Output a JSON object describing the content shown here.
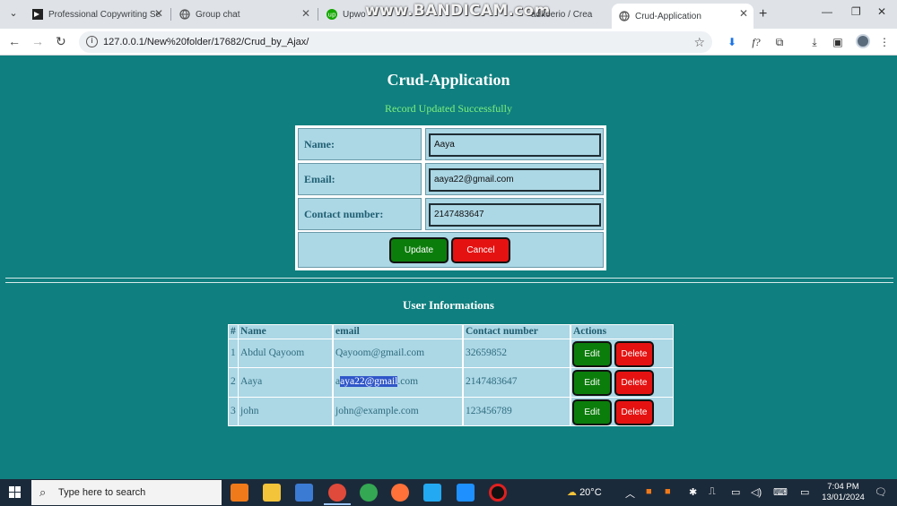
{
  "browser": {
    "tabs": [
      {
        "title": "Professional Copywriting Se",
        "active": false
      },
      {
        "title": "Group chat",
        "active": false
      },
      {
        "title": "Upwor",
        "active": false
      },
      {
        "title": "adkeerio / Crea",
        "active": false
      },
      {
        "title": "Crud-Application",
        "active": true
      }
    ],
    "new_tab_label": "+",
    "watermark": "www.BANDICAM.com",
    "url": "127.0.0.1/New%20folder/17682/Crud_by_Ajax/"
  },
  "page": {
    "title": "Crud-Application",
    "status_message": "Record Updated Successfully",
    "form": {
      "name_label": "Name:",
      "name_value": "Aaya",
      "email_label": "Email:",
      "email_value": "aaya22@gmail.com",
      "contact_label": "Contact number:",
      "contact_value": "2147483647",
      "update_label": "Update",
      "cancel_label": "Cancel"
    },
    "users_section": {
      "title": "User Informations",
      "headers": [
        "#",
        "Name",
        "email",
        "Contact number",
        "Actions"
      ],
      "rows": [
        {
          "id": "1",
          "name": "Abdul Qayoom",
          "email": "Qayoom@gmail.com",
          "contact": "32659852"
        },
        {
          "id": "2",
          "name": "Aaya",
          "email_pre": "a",
          "email_sel": "aya22@gmail",
          "email_post": ".com",
          "contact": "2147483647"
        },
        {
          "id": "3",
          "name": "john",
          "email": "john@example.com",
          "contact": "123456789"
        }
      ],
      "edit_label": "Edit",
      "delete_label": "Delete"
    }
  },
  "taskbar": {
    "search_placeholder": "Type here to search",
    "weather": "20°C",
    "time": "7:04 PM",
    "date": "13/01/2024"
  },
  "colors": {
    "page_bg": "#0f7f7f",
    "cell_bg": "#acd7e5",
    "success": "#7cf07c",
    "edit_button": "#0b7d0b",
    "delete_button": "#e51212"
  }
}
